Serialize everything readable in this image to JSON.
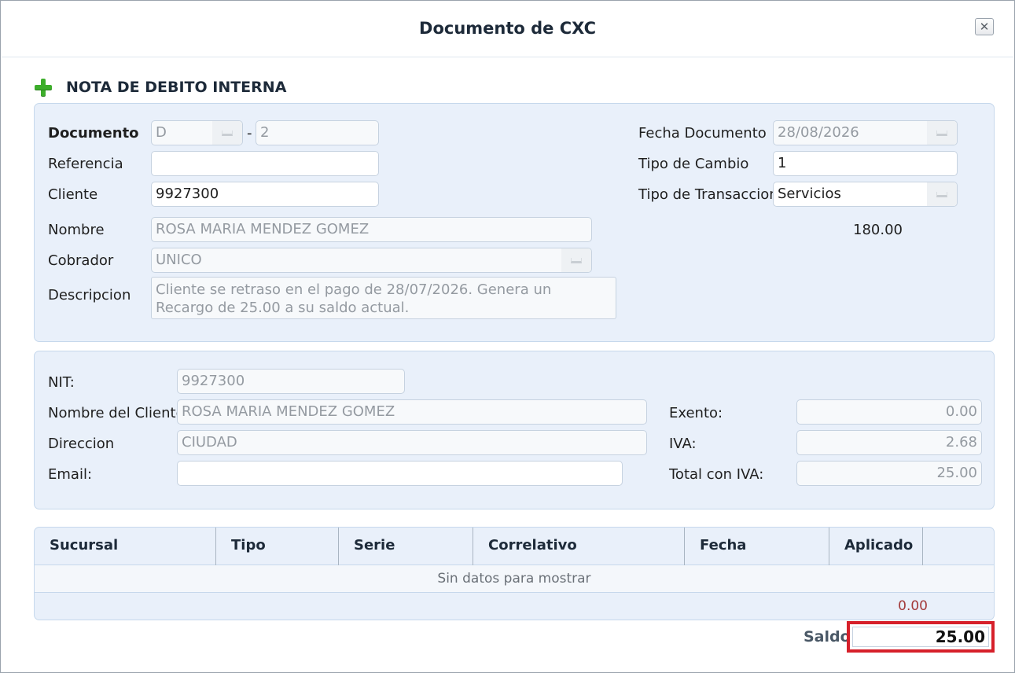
{
  "dialog": {
    "title": "Documento de CXC"
  },
  "section": {
    "title": "NOTA DE DEBITO INTERNA"
  },
  "document": {
    "documento_label": "Documento",
    "serie": "D",
    "separator": "-",
    "numero": "2",
    "referencia_label": "Referencia",
    "referencia": "",
    "cliente_label": "Cliente",
    "cliente": "9927300",
    "nombre_label": "Nombre",
    "nombre": "ROSA MARIA MENDEZ GOMEZ",
    "cobrador_label": "Cobrador",
    "cobrador": "UNICO",
    "descripcion_label": "Descripcion",
    "descripcion": "Cliente se retraso en el pago de 28/07/2026. Genera un Recargo de 25.00 a su saldo actual.",
    "fecha_label": "Fecha Documento",
    "fecha": "28/08/2026",
    "tipo_cambio_label": "Tipo de Cambio",
    "tipo_cambio": "1",
    "tipo_transaccion_label": "Tipo de Transaccion",
    "tipo_transaccion": "Servicios",
    "amount": "180.00"
  },
  "billing": {
    "nit_label": "NIT:",
    "nit": "9927300",
    "nombre_cliente_label": "Nombre del Cliente",
    "nombre_cliente": "ROSA MARIA MENDEZ GOMEZ",
    "direccion_label": "Direccion",
    "direccion": "CIUDAD",
    "email_label": "Email:",
    "email": "",
    "exento_label": "Exento:",
    "exento": "0.00",
    "iva_label": "IVA:",
    "iva": "2.68",
    "total_label": "Total con IVA:",
    "total": "25.00"
  },
  "grid": {
    "columns": [
      "Sucursal",
      "Tipo",
      "Serie",
      "Correlativo",
      "Fecha",
      "Aplicado"
    ],
    "empty_text": "Sin datos para mostrar",
    "total": "0.00"
  },
  "saldo": {
    "label": "Saldo",
    "value": "25.00"
  },
  "colors": {
    "panel_bg": "#e9f0fa",
    "highlight": "#d6202a",
    "plus_icon": "#3dae2b"
  },
  "icons": {
    "close": "close-icon",
    "add": "plus-icon",
    "dropdown": "dropdown-icon"
  }
}
